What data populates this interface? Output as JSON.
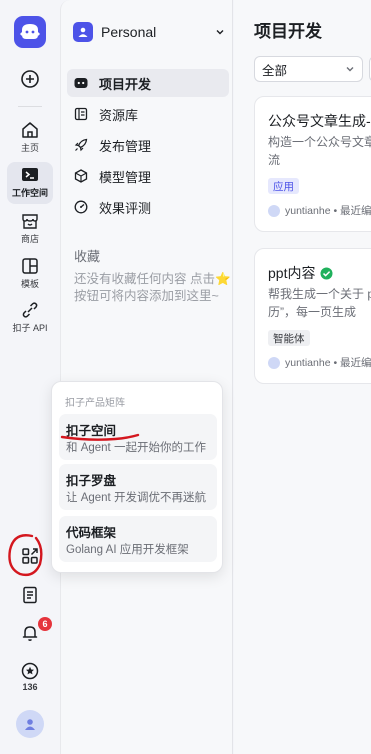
{
  "rail": {
    "items": [
      {
        "label": "主页",
        "icon": "home-icon"
      },
      {
        "label": "工作空间",
        "icon": "workspace-icon"
      },
      {
        "label": "商店",
        "icon": "store-icon"
      },
      {
        "label": "模板",
        "icon": "template-icon"
      },
      {
        "label": "扣子 API",
        "icon": "api-icon"
      }
    ],
    "notification_count": "6",
    "star_count": "136"
  },
  "workspace": {
    "name": "Personal",
    "nav": [
      {
        "label": "项目开发",
        "icon": "project-icon",
        "active": true
      },
      {
        "label": "资源库",
        "icon": "library-icon",
        "active": false
      },
      {
        "label": "发布管理",
        "icon": "publish-icon",
        "active": false
      },
      {
        "label": "模型管理",
        "icon": "model-icon",
        "active": false
      },
      {
        "label": "效果评测",
        "icon": "evaluation-icon",
        "active": false
      }
    ],
    "favorites_title": "收藏",
    "favorites_empty": "还没有收藏任何内容 点击⭐按钮可将内容添加到这里~"
  },
  "main": {
    "title": "项目开发",
    "filter_value": "全部",
    "cards": [
      {
        "title": "公众号文章生成-...",
        "desc": "构造一个公众号文章生成流",
        "tag": "应用",
        "author": "yuntianhe • 最近编"
      },
      {
        "title": "ppt内容",
        "desc": "帮我生成一个关于 ppt 来历”，每一页生成",
        "tag": "智能体",
        "author": "yuntianhe • 最近编"
      }
    ]
  },
  "popup": {
    "title": "扣子产品矩阵",
    "items": [
      {
        "title": "扣子空间",
        "subtitle": "和 Agent 一起开始你的工作"
      },
      {
        "title": "扣子罗盘",
        "subtitle": "让 Agent 开发调优不再迷航"
      },
      {
        "title": "代码框架",
        "subtitle": "Golang AI 应用开发框架"
      }
    ]
  },
  "colors": {
    "accent": "#4d53e8",
    "annotation": "#d4171f",
    "badge": "#e5343c"
  }
}
